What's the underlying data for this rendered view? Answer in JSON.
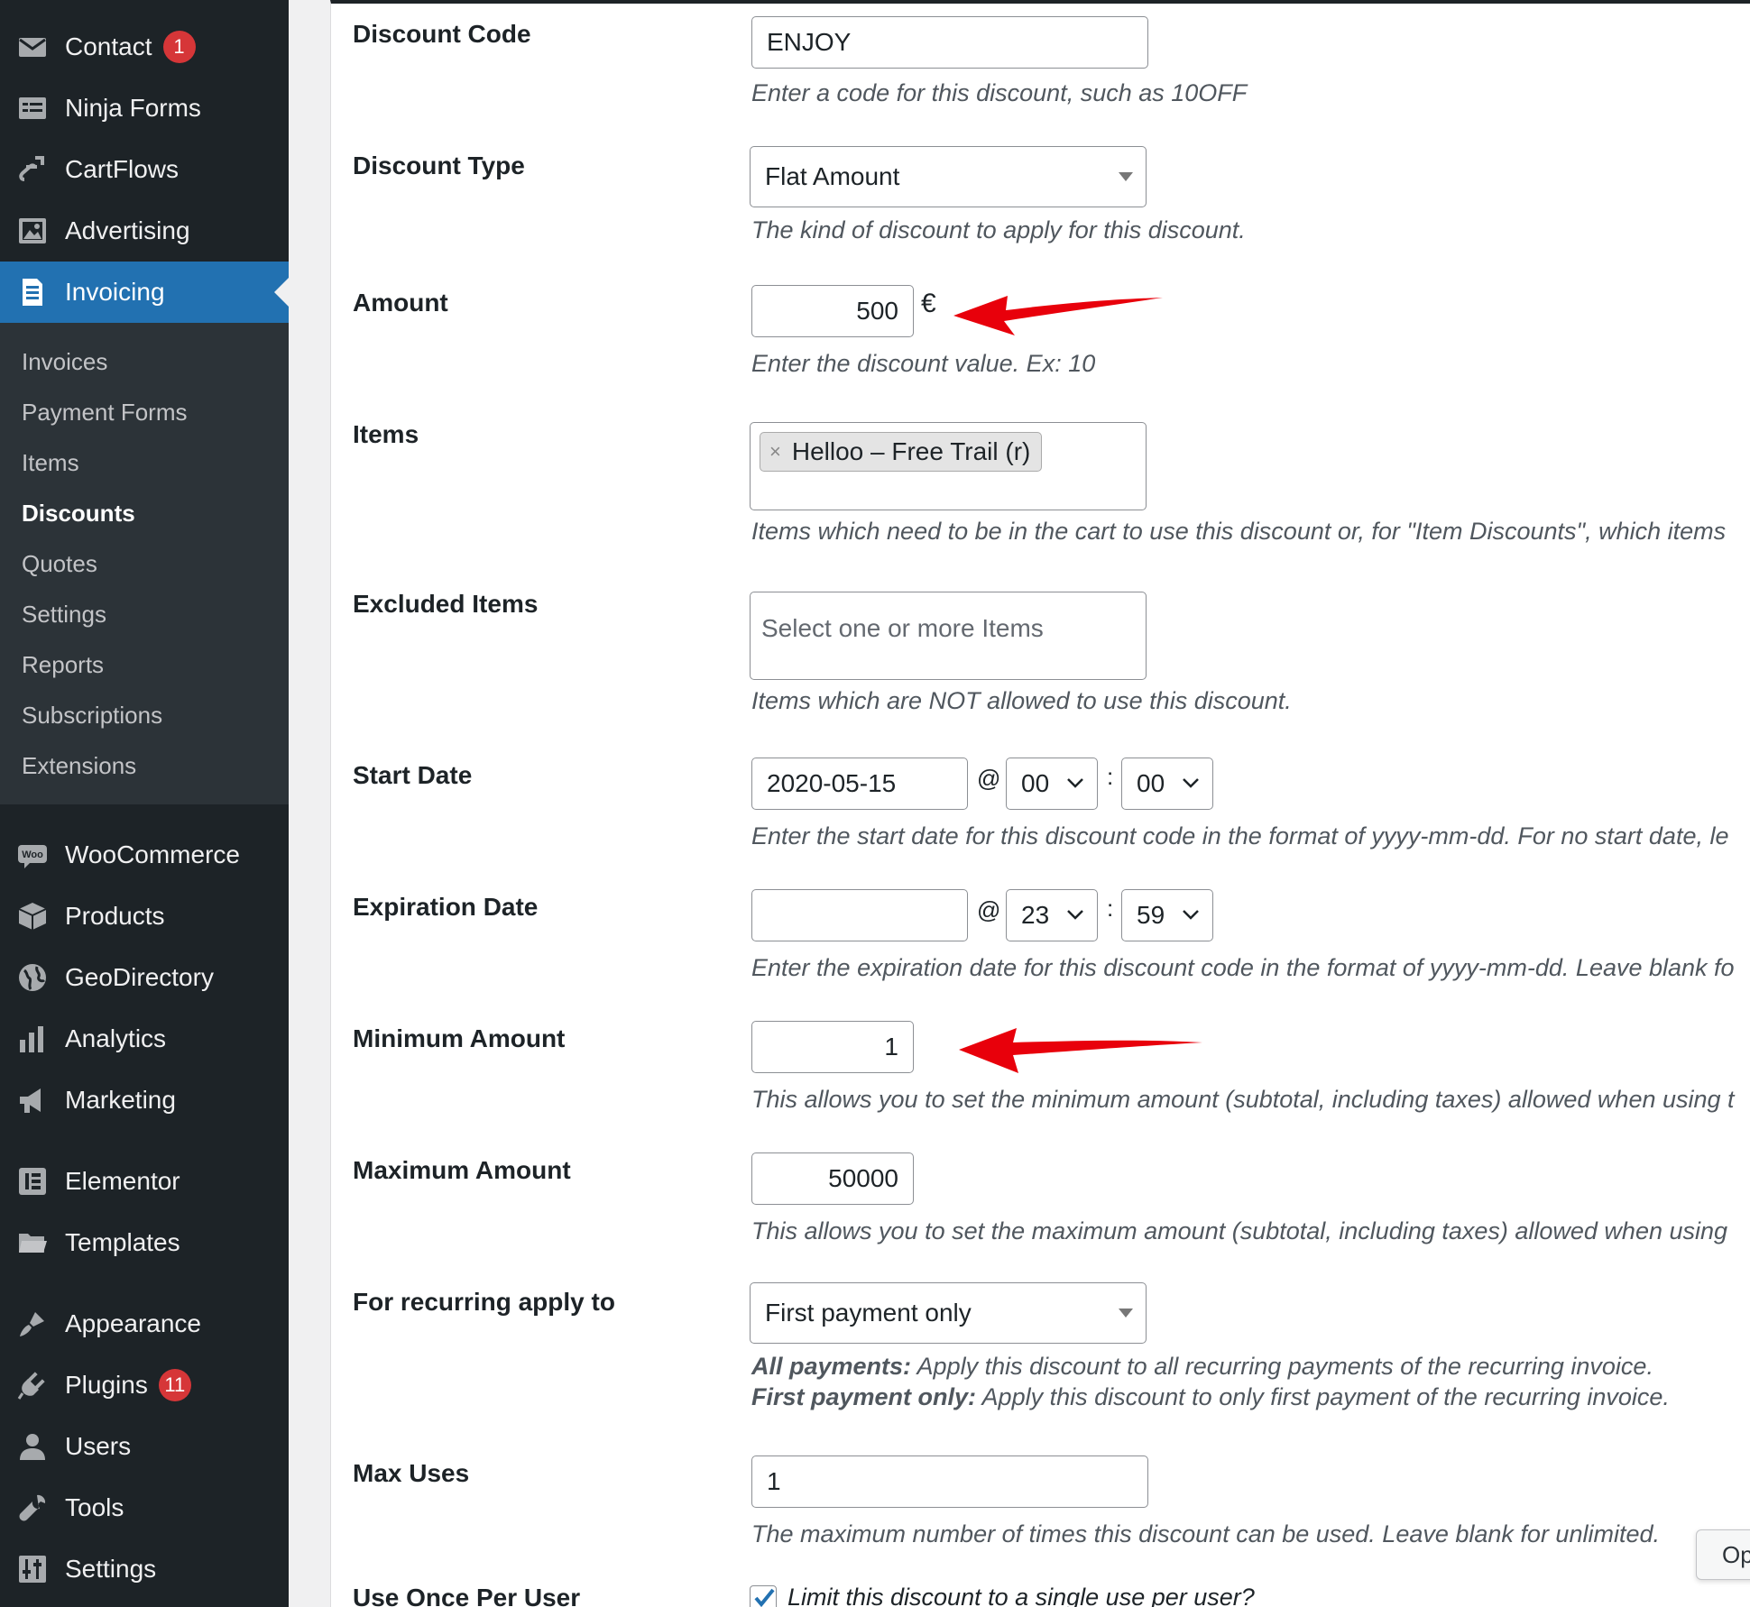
{
  "sidebar": {
    "top_items": [
      {
        "label": "Contact",
        "icon": "mail-icon",
        "badge": "1"
      },
      {
        "label": "Ninja Forms",
        "icon": "forms-icon"
      },
      {
        "label": "CartFlows",
        "icon": "cartflows-icon"
      },
      {
        "label": "Advertising",
        "icon": "image-icon"
      },
      {
        "label": "Invoicing",
        "icon": "invoice-icon",
        "active": true
      }
    ],
    "submenu": [
      "Invoices",
      "Payment Forms",
      "Items",
      "Discounts",
      "Quotes",
      "Settings",
      "Reports",
      "Subscriptions",
      "Extensions"
    ],
    "submenu_current": "Discounts",
    "lower_items": [
      {
        "label": "WooCommerce",
        "icon": "woo-icon"
      },
      {
        "label": "Products",
        "icon": "box-icon"
      },
      {
        "label": "GeoDirectory",
        "icon": "globe-icon"
      },
      {
        "label": "Analytics",
        "icon": "bar-chart-icon"
      },
      {
        "label": "Marketing",
        "icon": "megaphone-icon"
      },
      {
        "label": "Elementor",
        "icon": "elementor-icon"
      },
      {
        "label": "Templates",
        "icon": "folder-icon"
      },
      {
        "label": "Appearance",
        "icon": "brush-icon"
      },
      {
        "label": "Plugins",
        "icon": "plug-icon",
        "badge": "11"
      },
      {
        "label": "Users",
        "icon": "user-icon"
      },
      {
        "label": "Tools",
        "icon": "wrench-icon"
      },
      {
        "label": "Settings",
        "icon": "sliders-icon"
      }
    ]
  },
  "form": {
    "discount_code": {
      "label": "Discount Code",
      "value": "ENJOY",
      "desc": "Enter a code for this discount, such as 10OFF"
    },
    "discount_type": {
      "label": "Discount Type",
      "value": "Flat Amount",
      "desc": "The kind of discount to apply for this discount."
    },
    "amount": {
      "label": "Amount",
      "value": "500",
      "currency": "€",
      "desc": "Enter the discount value. Ex: 10"
    },
    "items": {
      "label": "Items",
      "chip": "Helloo – Free Trail (r)",
      "chip_remove": "×",
      "desc": "Items which need to be in the cart to use this discount or, for \"Item Discounts\", which items"
    },
    "excluded_items": {
      "label": "Excluded Items",
      "placeholder": "Select one or more Items",
      "desc": "Items which are NOT allowed to use this discount."
    },
    "start_date": {
      "label": "Start Date",
      "date": "2020-05-15",
      "at": "@",
      "hour": "00",
      "colon": ":",
      "minute": "00",
      "desc": "Enter the start date for this discount code in the format of yyyy-mm-dd. For no start date, le"
    },
    "expiration_date": {
      "label": "Expiration Date",
      "date": "",
      "at": "@",
      "hour": "23",
      "colon": ":",
      "minute": "59",
      "desc": "Enter the expiration date for this discount code in the format of yyyy-mm-dd. Leave blank fo"
    },
    "minimum_amount": {
      "label": "Minimum Amount",
      "value": "1",
      "desc": "This allows you to set the minimum amount (subtotal, including taxes) allowed when using t"
    },
    "maximum_amount": {
      "label": "Maximum Amount",
      "value": "50000",
      "desc": "This allows you to set the maximum amount (subtotal, including taxes) allowed when using"
    },
    "recurring": {
      "label": "For recurring apply to",
      "value": "First payment only",
      "desc_all_lead": "All payments:",
      "desc_all": " Apply this discount to all recurring payments of the recurring invoice.",
      "desc_first_lead": "First payment only:",
      "desc_first": " Apply this discount to only first payment of the recurring invoice."
    },
    "max_uses": {
      "label": "Max Uses",
      "value": "1",
      "desc": "The maximum number of times this discount can be used. Leave blank for unlimited."
    },
    "once_per_user": {
      "label": "Use Once Per User",
      "checked": true,
      "desc": "Limit this discount to a single use per user?"
    }
  },
  "side_button": {
    "label": "Op"
  },
  "colors": {
    "sidebar_bg": "#1d2327",
    "active": "#2271b1",
    "badge": "#d63638",
    "arrow": "#e8000b"
  }
}
